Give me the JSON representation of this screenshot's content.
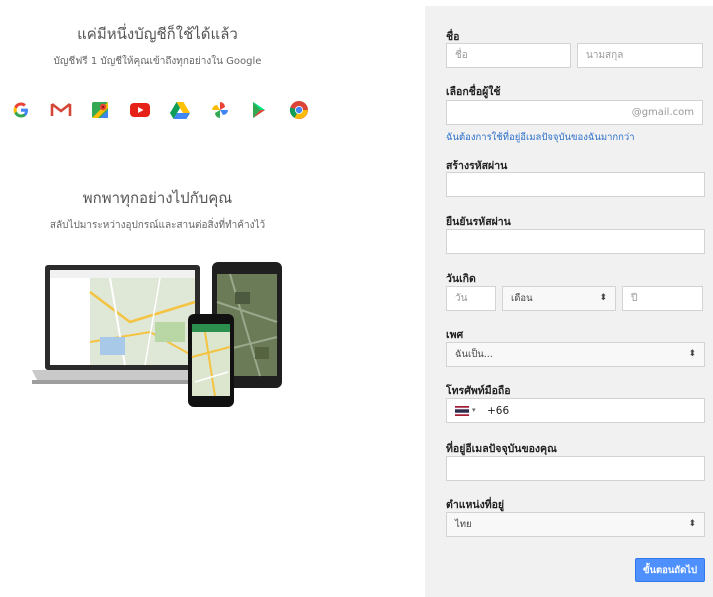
{
  "promo": {
    "title": "แค่มีหนึ่งบัญชีก็ใช้ได้แล้ว",
    "subtitle": "บัญชีฟรี 1 บัญชีให้คุณเข้าถึงทุกอย่างใน Google",
    "icons": [
      "google-g-icon",
      "gmail-icon",
      "maps-icon",
      "youtube-icon",
      "drive-icon",
      "photos-icon",
      "play-icon",
      "chrome-icon"
    ],
    "title2": "พกพาทุกอย่างไปกับคุณ",
    "subtitle2": "สลับไปมาระหว่างอุปกรณ์และสานต่อสิ่งที่ทำค้างไว้"
  },
  "form": {
    "name_label": "ชื่อ",
    "first_name_placeholder": "ชื่อ",
    "last_name_placeholder": "นามสกุล",
    "username_label": "เลือกชื่อผู้ใช้",
    "username_suffix": "@gmail.com",
    "use_current_email_link": "ฉันต้องการใช้ที่อยู่อีเมลปัจจุบันของฉันมากกว่า",
    "password_label": "สร้างรหัสผ่าน",
    "confirm_password_label": "ยืนยันรหัสผ่าน",
    "birthday_label": "วันเกิด",
    "day_placeholder": "วัน",
    "month_value": "เดือน",
    "year_placeholder": "ปี",
    "gender_label": "เพศ",
    "gender_value": "ฉันเป็น...",
    "mobile_label": "โทรศัพท์มือถือ",
    "country_code": "+66",
    "current_email_label": "ที่อยู่อีเมลปัจจุบันของคุณ",
    "location_label": "ตำแหน่งที่อยู่",
    "location_value": "ไทย",
    "next_button": "ขั้นตอนถัดไป"
  },
  "colors": {
    "accent": "#4d90fe",
    "link": "#2a6fc9",
    "panel_bg": "#f1f1f1"
  }
}
